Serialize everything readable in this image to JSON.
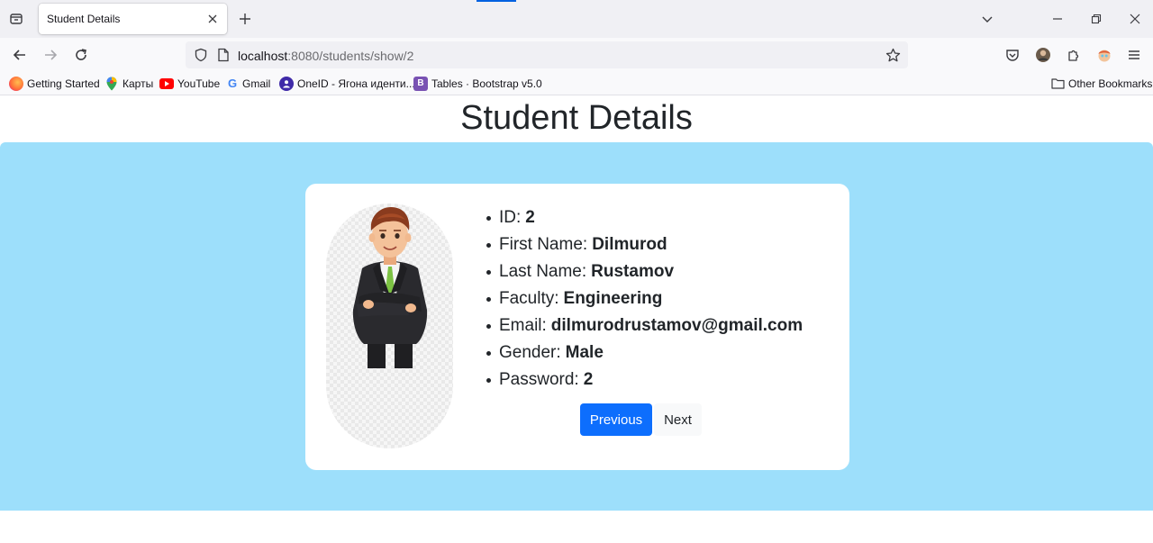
{
  "browser": {
    "tab": {
      "title": "Student Details"
    },
    "url": {
      "host": "localhost",
      "path": ":8080/students/show/2"
    },
    "bookmarks": [
      {
        "label": "Getting Started",
        "icon": "firefox-icon",
        "color": "#ff7139"
      },
      {
        "label": "Карты",
        "icon": "maps-pin-icon",
        "color": "#34a853"
      },
      {
        "label": "YouTube",
        "icon": "youtube-icon",
        "color": "#ff0000"
      },
      {
        "label": "Gmail",
        "icon": "google-icon",
        "color": "#4285f4"
      },
      {
        "label": "OneID - Ягона иденти...",
        "icon": "user-circle-icon",
        "color": "#3f2aa8"
      },
      {
        "label": "Tables · Bootstrap v5.0",
        "icon": "bootstrap-icon",
        "color": "#7952b3"
      }
    ],
    "other_bookmarks": "Other Bookmarks"
  },
  "page": {
    "title": "Student Details",
    "background_color": "#9ddffb",
    "student": {
      "fields": [
        {
          "label": "ID:",
          "value": "2"
        },
        {
          "label": "First Name:",
          "value": "Dilmurod"
        },
        {
          "label": "Last Name:",
          "value": "Rustamov"
        },
        {
          "label": "Faculty:",
          "value": "Engineering"
        },
        {
          "label": "Email:",
          "value": "dilmurodrustamov@gmail.com"
        },
        {
          "label": "Gender:",
          "value": "Male"
        },
        {
          "label": "Password:",
          "value": "2"
        }
      ]
    },
    "buttons": {
      "previous": "Previous",
      "next": "Next"
    }
  }
}
